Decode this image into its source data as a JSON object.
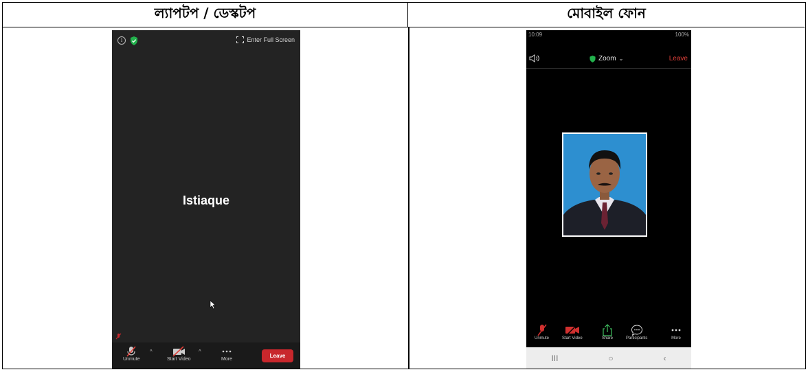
{
  "headers": {
    "laptop": "ল্যাপটপ / ডেস্কটপ",
    "mobile": "মোবাইল ফোন"
  },
  "desktop": {
    "fullscreen_label": "Enter Full Screen",
    "participant_name": "Istiaque",
    "toolbar": {
      "unmute": "Unmute",
      "start_video": "Start Video",
      "more": "More",
      "leave": "Leave"
    }
  },
  "mobile": {
    "status_time": "10:09",
    "status_right": "100%",
    "meeting_title": "Zoom",
    "leave": "Leave",
    "toolbar": {
      "unmute": "Unmute",
      "start_video": "Start Video",
      "share": "Share",
      "participants": "Participants",
      "more": "More"
    },
    "nav": [
      "III",
      "○",
      "‹"
    ]
  },
  "colors": {
    "leave_red": "#c8272c",
    "shield_green": "#22b14c",
    "window_bg": "#232323"
  },
  "icons": [
    "info-icon",
    "shield-icon",
    "fullscreen-icon",
    "mic-muted-icon",
    "video-off-icon",
    "more-icon",
    "speaker-icon",
    "share-icon",
    "participants-icon"
  ]
}
